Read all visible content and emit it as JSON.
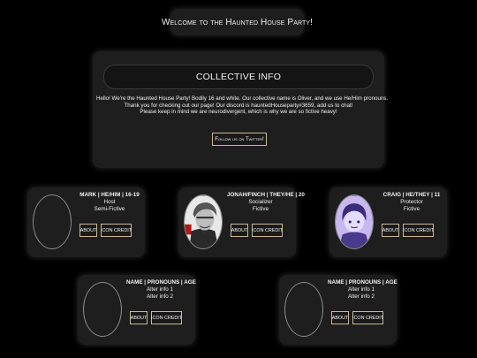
{
  "header": {
    "title": "Welcome to the Haunted House Party!"
  },
  "collective": {
    "heading": "COLLECTIVE INFO",
    "lines": [
      "Hello! We're the Haunted House Party! Bodily 16 and white. Our collective name is Oliver, and we use He/Him pronouns.",
      "Thank you for checking out our page! Our discord is hauntedHouseparty#3659, add us to chat!",
      "Please keep in mind we are neurodivergent, which is why we are so fictive heavy!"
    ],
    "twitter_button": "Follow us on Twitter!"
  },
  "alters": [
    {
      "name": "MARK | HE/HIM | 16-19",
      "line1": "Host",
      "line2": "Semi-Fictive",
      "about": "ABOUT",
      "credit": "ICON CREDIT",
      "avatar": "empty"
    },
    {
      "name": "JONAH/FINCH | THEY/HE | 20",
      "line1": "Socializer",
      "line2": "Fictive",
      "about": "ABOUT",
      "credit": "ICON CREDIT",
      "avatar": "monochrome-character-portrait"
    },
    {
      "name": "CRAIG | HE/THEY | 11",
      "line1": "Protector",
      "line2": "Fictive",
      "about": "ABOUT",
      "credit": "ICON CREDIT",
      "avatar": "purple-character-portrait"
    },
    {
      "name": "NAME | PRONOUNS | AGE",
      "line1": "Alter info 1",
      "line2": "Alter info 2",
      "about": "ABOUT",
      "credit": "ICON CREDIT",
      "avatar": "empty"
    },
    {
      "name": "NAME | PRONOUNS | AGE",
      "line1": "Alter info 1",
      "line2": "Alter info 2",
      "about": "ABOUT",
      "credit": "ICON CREDIT",
      "avatar": "empty"
    }
  ],
  "colors": {
    "background": "#000000",
    "panel": "#1e1e1e",
    "button_border": "#c9b994",
    "text": "#f2f2f2"
  }
}
